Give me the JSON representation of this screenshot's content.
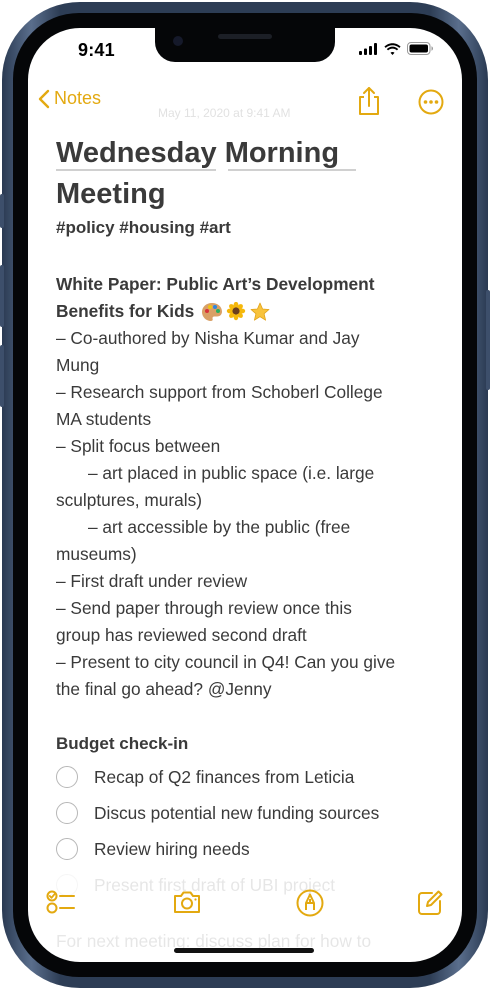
{
  "status_bar": {
    "time": "9:41"
  },
  "nav": {
    "back_label": "Notes",
    "ghost_date": "May 11, 2020 at 9:41 AM"
  },
  "note": {
    "title_line1": "Wednesday Morning",
    "title_line2": "Meeting",
    "tags": "#policy #housing #art",
    "body": {
      "heading_line1": "White Paper: Public Art’s Development",
      "heading_line2": "Benefits for Kids",
      "lines": [
        "– Co-authored by Nisha Kumar and Jay",
        "Mung",
        "– Research support from Schoberl College",
        "MA students",
        "– Split focus between",
        "– art placed in public space (i.e. large",
        "sculptures, murals)",
        "– art accessible by the public (free",
        "museums)",
        "– First draft under review",
        "– Send paper through review once this",
        "group has reviewed second draft",
        "– Present to city council in Q4! Can you give",
        "the final go ahead? @Jenny"
      ]
    },
    "budget": {
      "heading": "Budget check-in",
      "items": [
        "Recap of Q2 finances from Leticia",
        "Discus potential new funding sources",
        "Review hiring needs",
        "Present first draft of UBI project"
      ]
    },
    "faded_footer": "For next meeting: discuss plan for how to"
  },
  "toolbar": {
    "items": [
      "checklist-icon",
      "camera-icon",
      "markup-icon",
      "compose-icon"
    ]
  },
  "colors": {
    "accent": "#e3a910",
    "text": "#3a3a3a",
    "frame": "#2d3d55"
  }
}
